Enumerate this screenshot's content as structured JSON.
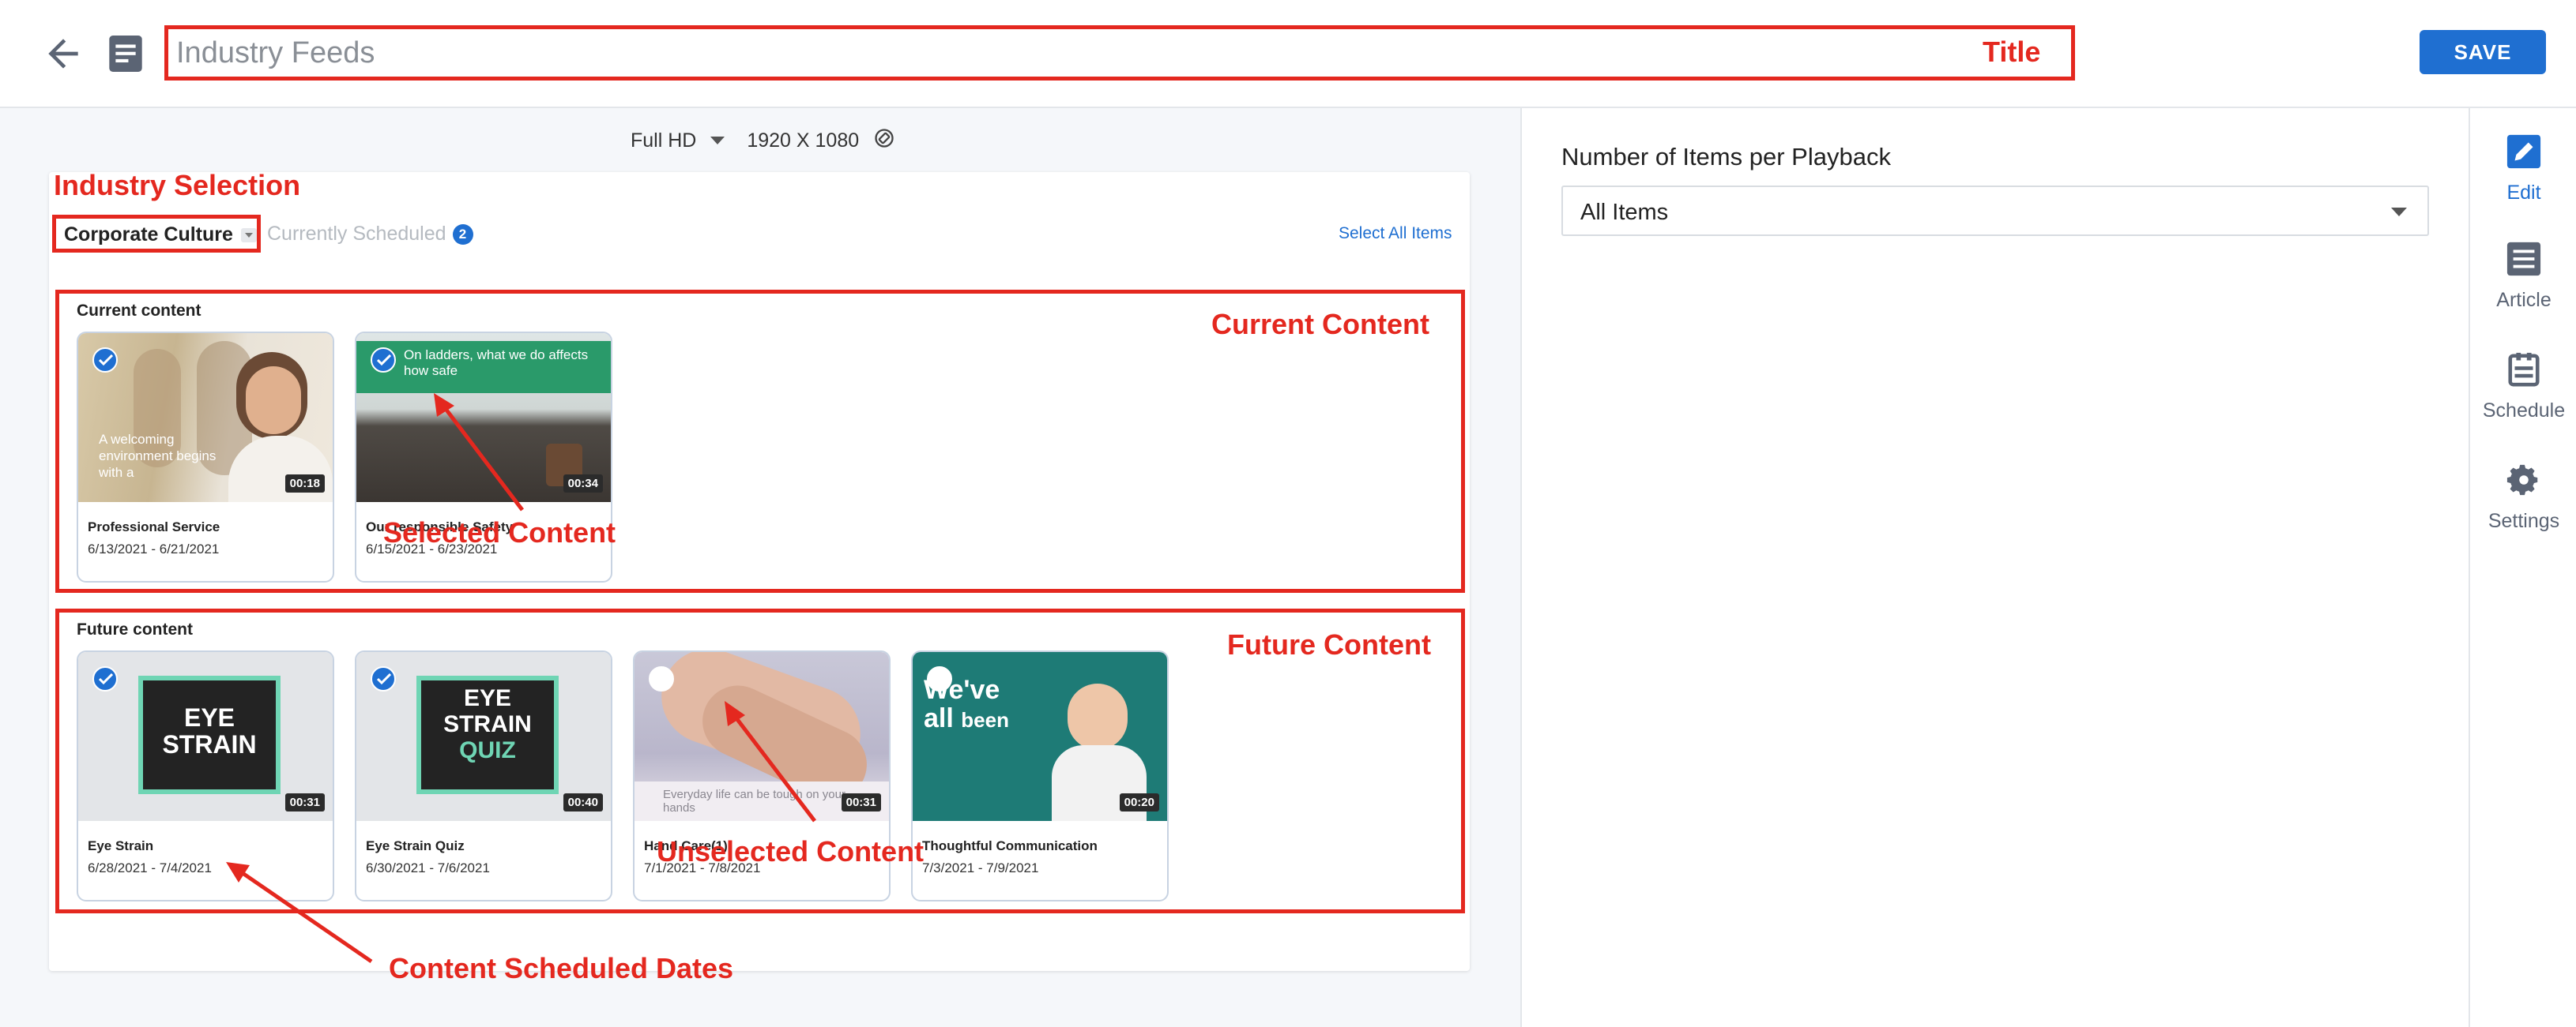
{
  "header": {
    "title_placeholder": "Industry Feeds",
    "save_label": "SAVE"
  },
  "annotations": {
    "title": "Title",
    "industry_selection": "Industry Selection",
    "current_content": "Current Content",
    "selected_content": "Selected Content",
    "future_content": "Future Content",
    "unselected_content": "Unselected Content",
    "scheduled_dates": "Content Scheduled Dates"
  },
  "resolution": {
    "preset": "Full HD",
    "dimensions": "1920 X 1080"
  },
  "toolbar": {
    "industry": "Corporate Culture",
    "scheduled_label": "Currently Scheduled",
    "scheduled_count": "2",
    "select_all": "Select All Items"
  },
  "current": {
    "label": "Current content",
    "items": [
      {
        "name": "Professional Service",
        "dates": "6/13/2021 - 6/21/2021",
        "duration": "00:18",
        "selected": true,
        "thumb_text": "A welcoming environment begins with a"
      },
      {
        "name": "Our responsible Safety",
        "dates": "6/15/2021 - 6/23/2021",
        "duration": "00:34",
        "selected": true,
        "thumb_text": "On ladders, what we do affects how safe"
      }
    ]
  },
  "future": {
    "label": "Future content",
    "items": [
      {
        "name": "Eye Strain",
        "dates": "6/28/2021 - 7/4/2021",
        "duration": "00:31",
        "selected": true,
        "thumb_line1": "EYE",
        "thumb_line2": "STRAIN"
      },
      {
        "name": "Eye Strain Quiz",
        "dates": "6/30/2021 - 7/6/2021",
        "duration": "00:40",
        "selected": true,
        "thumb_line1": "EYE",
        "thumb_line2": "STRAIN",
        "thumb_line3": "QUIZ"
      },
      {
        "name": "Hand Care(1)",
        "dates": "7/1/2021 - 7/8/2021",
        "duration": "00:31",
        "selected": false,
        "thumb_text": "Everyday life can be tough on your hands"
      },
      {
        "name": "Thoughtful Communication",
        "dates": "7/3/2021 - 7/9/2021",
        "duration": "00:20",
        "selected": false,
        "thumb_line1": "We've",
        "thumb_line2": "all",
        "thumb_line3": "been"
      }
    ]
  },
  "panel": {
    "label": "Number of Items per Playback",
    "value": "All Items"
  },
  "nav": [
    {
      "label": "Edit",
      "icon": "pencil-icon"
    },
    {
      "label": "Article",
      "icon": "article-icon"
    },
    {
      "label": "Schedule",
      "icon": "schedule-icon"
    },
    {
      "label": "Settings",
      "icon": "gear-icon"
    }
  ],
  "colors": {
    "accent": "#1f6fd1",
    "annotation": "#e4281f"
  }
}
